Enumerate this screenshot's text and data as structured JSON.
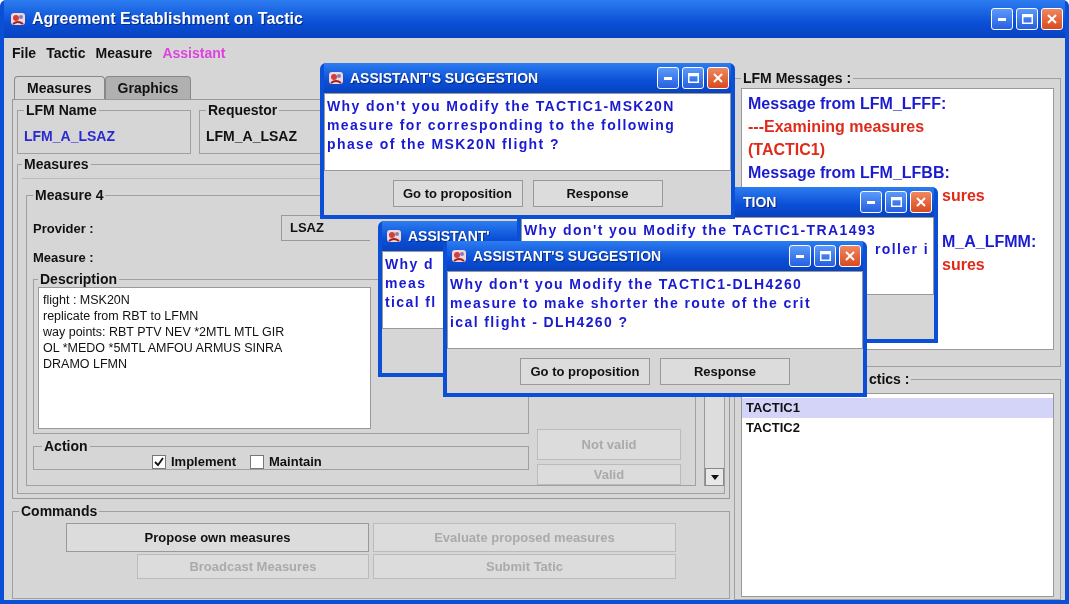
{
  "window": {
    "title": "Agreement Establishment on Tactic"
  },
  "menu": [
    {
      "label": "File",
      "selected": false
    },
    {
      "label": "Tactic",
      "selected": false
    },
    {
      "label": "Measure",
      "selected": false
    },
    {
      "label": "Assistant",
      "selected": true
    }
  ],
  "tabs": [
    {
      "label": "Measures",
      "selected": true
    },
    {
      "label": "Graphics",
      "selected": false
    }
  ],
  "lfm_name": {
    "label": "LFM Name",
    "value": "LFM_A_LSAZ"
  },
  "requestor": {
    "label": "Requestor",
    "value": "LFM_A_LSAZ"
  },
  "measures": {
    "label": "Measures",
    "title": "Measure 4",
    "provider_label": "Provider :",
    "provider": "LSAZ",
    "measure_label": "Measure :",
    "description_label": "Description",
    "description": [
      "flight : MSK20N",
      "replicate from RBT to LFMN",
      "way points: RBT PTV NEV *2MTL MTL GIR",
      "OL *MEDO *5MTL AMFOU ARMUS SINRA",
      "DRAMO LFMN"
    ],
    "action_label": "Action",
    "actions": [
      {
        "label": "Implement",
        "checked": true
      },
      {
        "label": "Maintain",
        "checked": false
      }
    ],
    "buttons": [
      {
        "label": "Not valid",
        "disabled": true
      },
      {
        "label": "Valid",
        "disabled": true
      }
    ]
  },
  "commands": {
    "label": "Commands",
    "buttons": [
      {
        "label": "Propose own measures",
        "disabled": false
      },
      {
        "label": "Evaluate proposed  measures",
        "disabled": true
      },
      {
        "label": "Broadcast Measures",
        "disabled": true
      },
      {
        "label": "Submit Tatic",
        "disabled": true
      }
    ]
  },
  "messages": {
    "label": "LFM Messages :",
    "lines": [
      {
        "text": "Message from LFM_LFFF:",
        "color": "#1a1ad0",
        "kind": "full"
      },
      {
        "text": "---Examining measures",
        "color": "#e02a1a",
        "kind": "full"
      },
      {
        "text": "(TACTIC1)",
        "color": "#e02a1a",
        "kind": "full"
      },
      {
        "text": "Message from LFM_LFBB:",
        "color": "#1a1ad0",
        "kind": "full"
      },
      {
        "text": "sures",
        "color": "#e02a1a",
        "kind": "tail"
      },
      {
        "text": "M_A_LFMM:",
        "color": "#1a1ad0",
        "kind": "tail_gap"
      },
      {
        "text": "sures",
        "color": "#e02a1a",
        "kind": "tail"
      }
    ]
  },
  "tactics": {
    "label": "ctics :",
    "items": [
      {
        "label": "TACTIC1",
        "selected": true
      },
      {
        "label": "TACTIC2",
        "selected": false
      }
    ]
  },
  "dialogs": [
    {
      "title": {
        "text": "ASSISTANT'",
        "kind": "head"
      },
      "lines": [
        {
          "text": "Why d",
          "kind": "full"
        },
        {
          "text": "meas",
          "kind": "full"
        },
        {
          "text": "tical fl",
          "kind": "full"
        }
      ]
    },
    {
      "title": {
        "text": "TION",
        "kind": "tail"
      },
      "lines": [
        {
          "text": "Why don't you Modify the TACTIC1-TRA1493",
          "kind": "full"
        },
        {
          "text": "roller i",
          "kind": "tail"
        }
      ]
    },
    {
      "title": {
        "text": "ASSISTANT'S SUGGESTION",
        "kind": "full"
      },
      "lines": [
        {
          "text": "Why don't you Modify the TACTIC1-MSK20N",
          "kind": "full"
        },
        {
          "text": "measure for corresponding to the following",
          "kind": "full"
        },
        {
          "text": "phase of the MSK20N flight ?",
          "kind": "full"
        }
      ],
      "buttons": [
        "Go to proposition",
        "Response"
      ]
    },
    {
      "title": {
        "text": "ASSISTANT'S SUGGESTION",
        "kind": "full"
      },
      "lines": [
        {
          "text": "Why don't you Modify the TACTIC1-DLH4260",
          "kind": "full"
        },
        {
          "text": "measure to make shorter the route of the crit",
          "kind": "full"
        },
        {
          "text": "ical flight - DLH4260 ?",
          "kind": "full"
        }
      ],
      "buttons": [
        "Go to proposition",
        "Response"
      ]
    }
  ]
}
